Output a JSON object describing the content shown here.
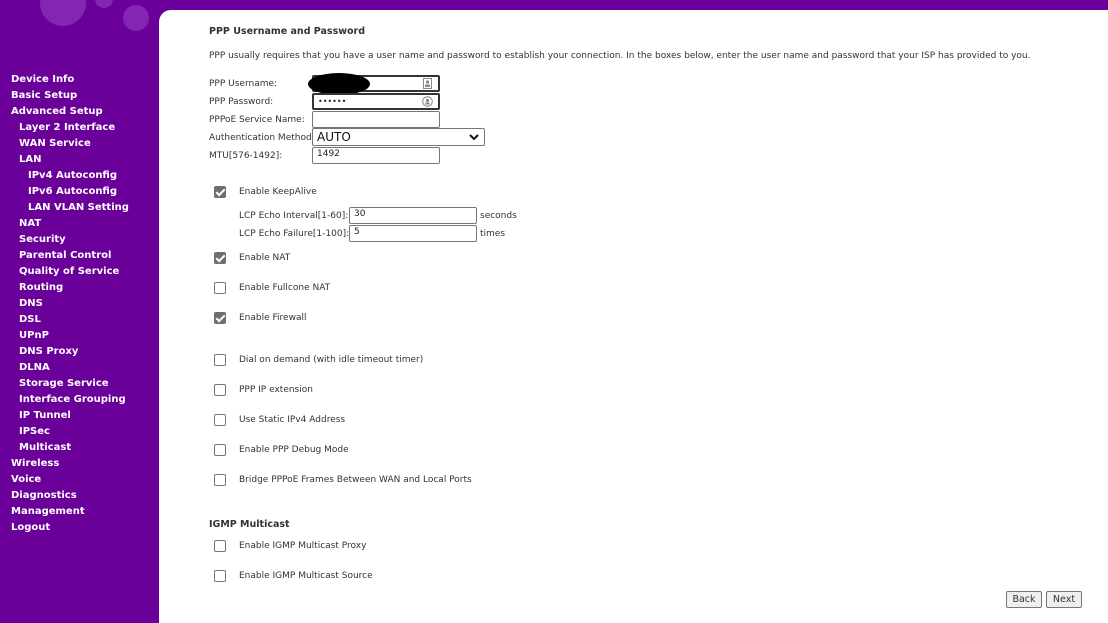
{
  "sidebar": {
    "items": [
      {
        "label": "Device Info",
        "level": 0
      },
      {
        "label": "Basic Setup",
        "level": 0
      },
      {
        "label": "Advanced Setup",
        "level": 0
      },
      {
        "label": "Layer 2 Interface",
        "level": 1
      },
      {
        "label": "WAN Service",
        "level": 1
      },
      {
        "label": "LAN",
        "level": 1
      },
      {
        "label": "IPv4 Autoconfig",
        "level": 2
      },
      {
        "label": "IPv6 Autoconfig",
        "level": 2
      },
      {
        "label": "LAN VLAN Setting",
        "level": 2
      },
      {
        "label": "NAT",
        "level": 1
      },
      {
        "label": "Security",
        "level": 1
      },
      {
        "label": "Parental Control",
        "level": 1
      },
      {
        "label": "Quality of Service",
        "level": 1
      },
      {
        "label": "Routing",
        "level": 1
      },
      {
        "label": "DNS",
        "level": 1
      },
      {
        "label": "DSL",
        "level": 1
      },
      {
        "label": "UPnP",
        "level": 1
      },
      {
        "label": "DNS Proxy",
        "level": 1
      },
      {
        "label": "DLNA",
        "level": 1
      },
      {
        "label": "Storage Service",
        "level": 1
      },
      {
        "label": "Interface Grouping",
        "level": 1
      },
      {
        "label": "IP Tunnel",
        "level": 1
      },
      {
        "label": "IPSec",
        "level": 1
      },
      {
        "label": "Multicast",
        "level": 1
      },
      {
        "label": "Wireless",
        "level": 0
      },
      {
        "label": "Voice",
        "level": 0
      },
      {
        "label": "Diagnostics",
        "level": 0
      },
      {
        "label": "Management",
        "level": 0
      },
      {
        "label": "Logout",
        "level": 0
      }
    ]
  },
  "ppp": {
    "title": "PPP Username and Password",
    "description": "PPP usually requires that you have a user name and password to establish your connection. In the boxes below, enter the user name and password that your ISP has provided to you.",
    "username_label": "PPP Username:",
    "username_value": "",
    "password_label": "PPP Password:",
    "password_value": "••••••",
    "service_label": "PPPoE Service Name:",
    "service_value": "",
    "auth_label": "Authentication Method:",
    "auth_value": "AUTO",
    "mtu_label": "MTU[576-1492]:",
    "mtu_value": "1492"
  },
  "keepalive": {
    "label": "Enable KeepAlive",
    "checked": true,
    "echo_interval_label": "LCP Echo Interval[1-60]:",
    "echo_interval_value": "30",
    "echo_interval_unit": "seconds",
    "echo_failure_label": "LCP Echo Failure[1-100]:",
    "echo_failure_value": "5",
    "echo_failure_unit": "times"
  },
  "options": [
    {
      "label": "Enable NAT",
      "checked": true
    },
    {
      "label": "Enable Fullcone NAT",
      "checked": false
    },
    {
      "label": "Enable Firewall",
      "checked": true
    },
    {
      "label": "Dial on demand (with idle timeout timer)",
      "checked": false
    },
    {
      "label": "PPP IP extension",
      "checked": false
    },
    {
      "label": "Use Static IPv4 Address",
      "checked": false
    },
    {
      "label": "Enable PPP Debug Mode",
      "checked": false
    },
    {
      "label": "Bridge PPPoE Frames Between WAN and Local Ports",
      "checked": false
    }
  ],
  "igmp": {
    "title": "IGMP Multicast",
    "options": [
      {
        "label": "Enable IGMP Multicast Proxy",
        "checked": false
      },
      {
        "label": "Enable IGMP Multicast Source",
        "checked": false
      }
    ]
  },
  "buttons": {
    "back": "Back",
    "next": "Next"
  },
  "colors": {
    "sidebar_bg": "#6a0099",
    "checkbox_checked": "#6f6f6f"
  }
}
